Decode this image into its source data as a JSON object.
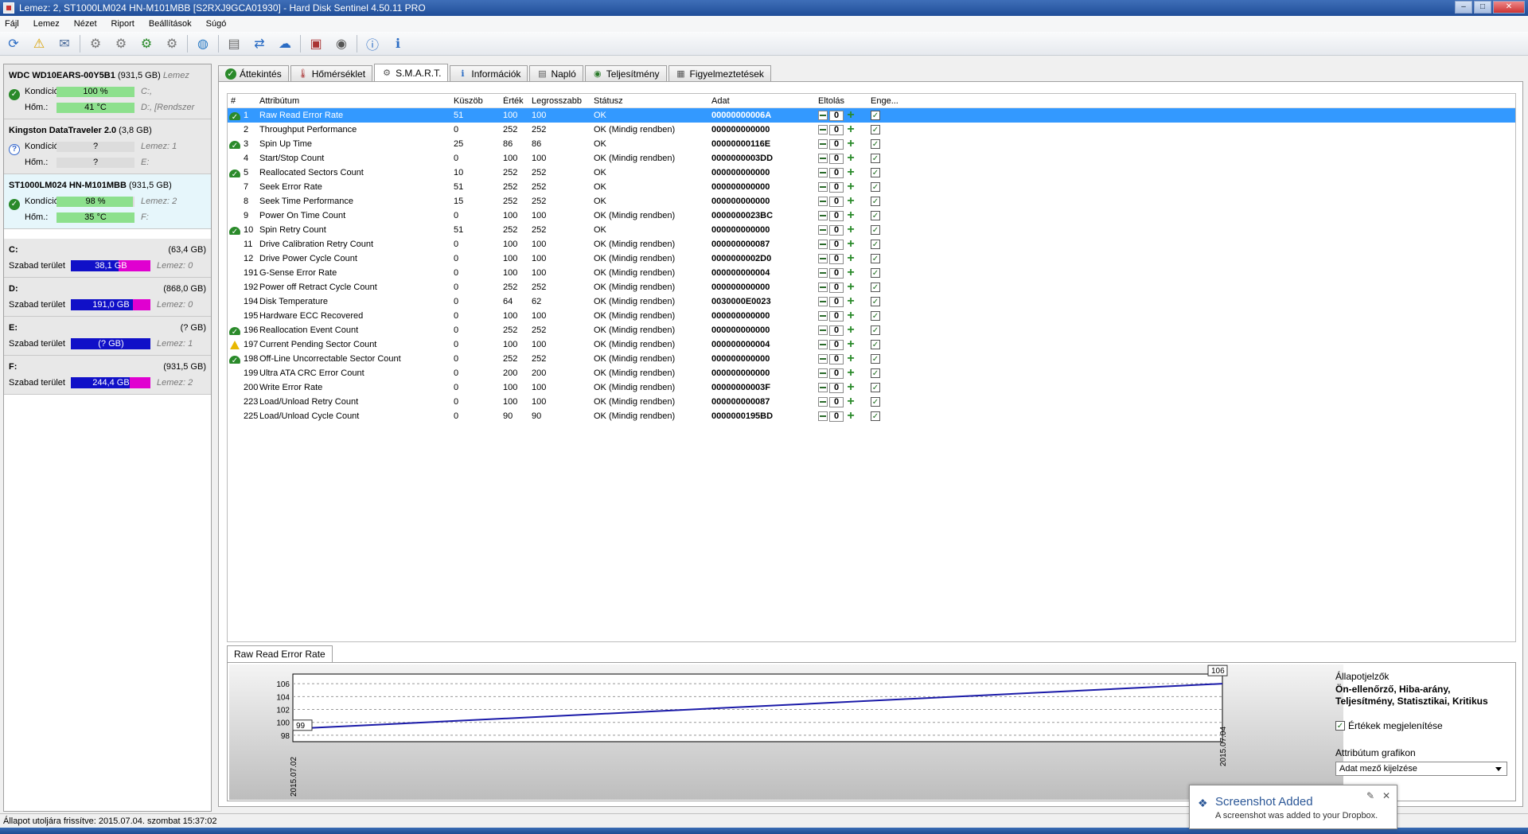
{
  "window": {
    "title": "Lemez: 2, ST1000LM024 HN-M101MBB [S2RXJ9GCA01930]  -  Hard Disk Sentinel 4.50.11 PRO",
    "min": "–",
    "max": "□",
    "close": "✕"
  },
  "menu": [
    "Fájl",
    "Lemez",
    "Nézet",
    "Riport",
    "Beállítások",
    "Súgó"
  ],
  "disks": [
    {
      "name": "WDC WD10EARS-00Y5B1",
      "size": "(931,5 GB)",
      "tail": "Lemez",
      "cond_label": "Kondíció:",
      "cond": "100 %",
      "cond_pct": 100,
      "cond_extra": "C:,",
      "temp_label": "Hőm.:",
      "temp": "41 °C",
      "temp_extra": "D:, [Rendszer",
      "status": "ok"
    },
    {
      "name": "Kingston DataTraveler 2.0",
      "size": "(3,8 GB)",
      "tail": "",
      "cond_label": "Kondíció:",
      "cond": "?",
      "cond_pct": 0,
      "cond_extra": "Lemez: 1",
      "temp_label": "Hőm.:",
      "temp": "?",
      "temp_extra": "E:",
      "status": "unknown"
    },
    {
      "name": "ST1000LM024 HN-M101MBB",
      "size": "(931,5 GB)",
      "tail": "",
      "cond_label": "Kondíció:",
      "cond": "98 %",
      "cond_pct": 98,
      "cond_extra": "Lemez: 2",
      "temp_label": "Hőm.:",
      "temp": "35 °C",
      "temp_extra": "F:",
      "status": "ok"
    }
  ],
  "volumes": [
    {
      "letter": "C:",
      "size": "(63,4 GB)",
      "free_label": "Szabad terület",
      "free": "38,1 GB",
      "free_pct": 60,
      "disk": "Lemez: 0"
    },
    {
      "letter": "D:",
      "size": "(868,0 GB)",
      "free_label": "Szabad terület",
      "free": "191,0 GB",
      "free_pct": 78,
      "disk": "Lemez: 0"
    },
    {
      "letter": "E:",
      "size": "(? GB)",
      "free_label": "Szabad terület",
      "free": "(? GB)",
      "free_pct": 100,
      "disk": "Lemez: 1"
    },
    {
      "letter": "F:",
      "size": "(931,5 GB)",
      "free_label": "Szabad terület",
      "free": "244,4 GB",
      "free_pct": 74,
      "disk": "Lemez: 2"
    }
  ],
  "tabs": [
    "Áttekintés",
    "Hőmérséklet",
    "S.M.A.R.T.",
    "Információk",
    "Napló",
    "Teljesítmény",
    "Figyelmeztetések"
  ],
  "tab_icons": [
    "check-icon",
    "thermometer-icon",
    "smart-icon",
    "info-icon",
    "log-icon",
    "performance-icon",
    "warning-list-icon"
  ],
  "smart_headers": [
    "#",
    "Attribútum",
    "Küszöb",
    "Érték",
    "Legrosszabb",
    "Státusz",
    "Adat",
    "Eltolás",
    "Enge..."
  ],
  "smart_rows": [
    {
      "id": "1",
      "name": "Raw Read Error Rate",
      "thr": "51",
      "val": "100",
      "worst": "100",
      "status": "OK",
      "data": "00000000006A",
      "off": "0",
      "icon": "ok"
    },
    {
      "id": "2",
      "name": "Throughput Performance",
      "thr": "0",
      "val": "252",
      "worst": "252",
      "status": "OK (Mindig rendben)",
      "data": "000000000000",
      "off": "0",
      "icon": ""
    },
    {
      "id": "3",
      "name": "Spin Up Time",
      "thr": "25",
      "val": "86",
      "worst": "86",
      "status": "OK",
      "data": "00000000116E",
      "off": "0",
      "icon": "ok"
    },
    {
      "id": "4",
      "name": "Start/Stop Count",
      "thr": "0",
      "val": "100",
      "worst": "100",
      "status": "OK (Mindig rendben)",
      "data": "0000000003DD",
      "off": "0",
      "icon": ""
    },
    {
      "id": "5",
      "name": "Reallocated Sectors Count",
      "thr": "10",
      "val": "252",
      "worst": "252",
      "status": "OK",
      "data": "000000000000",
      "off": "0",
      "icon": "ok"
    },
    {
      "id": "7",
      "name": "Seek Error Rate",
      "thr": "51",
      "val": "252",
      "worst": "252",
      "status": "OK",
      "data": "000000000000",
      "off": "0",
      "icon": ""
    },
    {
      "id": "8",
      "name": "Seek Time Performance",
      "thr": "15",
      "val": "252",
      "worst": "252",
      "status": "OK",
      "data": "000000000000",
      "off": "0",
      "icon": ""
    },
    {
      "id": "9",
      "name": "Power On Time Count",
      "thr": "0",
      "val": "100",
      "worst": "100",
      "status": "OK (Mindig rendben)",
      "data": "0000000023BC",
      "off": "0",
      "icon": ""
    },
    {
      "id": "10",
      "name": "Spin Retry Count",
      "thr": "51",
      "val": "252",
      "worst": "252",
      "status": "OK",
      "data": "000000000000",
      "off": "0",
      "icon": "ok"
    },
    {
      "id": "11",
      "name": "Drive Calibration Retry Count",
      "thr": "0",
      "val": "100",
      "worst": "100",
      "status": "OK (Mindig rendben)",
      "data": "000000000087",
      "off": "0",
      "icon": ""
    },
    {
      "id": "12",
      "name": "Drive Power Cycle Count",
      "thr": "0",
      "val": "100",
      "worst": "100",
      "status": "OK (Mindig rendben)",
      "data": "0000000002D0",
      "off": "0",
      "icon": ""
    },
    {
      "id": "191",
      "name": "G-Sense Error Rate",
      "thr": "0",
      "val": "100",
      "worst": "100",
      "status": "OK (Mindig rendben)",
      "data": "000000000004",
      "off": "0",
      "icon": ""
    },
    {
      "id": "192",
      "name": "Power off Retract Cycle Count",
      "thr": "0",
      "val": "252",
      "worst": "252",
      "status": "OK (Mindig rendben)",
      "data": "000000000000",
      "off": "0",
      "icon": ""
    },
    {
      "id": "194",
      "name": "Disk Temperature",
      "thr": "0",
      "val": "64",
      "worst": "62",
      "status": "OK (Mindig rendben)",
      "data": "0030000E0023",
      "off": "0",
      "icon": ""
    },
    {
      "id": "195",
      "name": "Hardware ECC Recovered",
      "thr": "0",
      "val": "100",
      "worst": "100",
      "status": "OK (Mindig rendben)",
      "data": "000000000000",
      "off": "0",
      "icon": ""
    },
    {
      "id": "196",
      "name": "Reallocation Event Count",
      "thr": "0",
      "val": "252",
      "worst": "252",
      "status": "OK (Mindig rendben)",
      "data": "000000000000",
      "off": "0",
      "icon": "ok"
    },
    {
      "id": "197",
      "name": "Current Pending Sector Count",
      "thr": "0",
      "val": "100",
      "worst": "100",
      "status": "OK (Mindig rendben)",
      "data": "000000000004",
      "off": "0",
      "icon": "warn"
    },
    {
      "id": "198",
      "name": "Off-Line Uncorrectable Sector Count",
      "thr": "0",
      "val": "252",
      "worst": "252",
      "status": "OK (Mindig rendben)",
      "data": "000000000000",
      "off": "0",
      "icon": "ok"
    },
    {
      "id": "199",
      "name": "Ultra ATA CRC Error Count",
      "thr": "0",
      "val": "200",
      "worst": "200",
      "status": "OK (Mindig rendben)",
      "data": "000000000000",
      "off": "0",
      "icon": ""
    },
    {
      "id": "200",
      "name": "Write Error Rate",
      "thr": "0",
      "val": "100",
      "worst": "100",
      "status": "OK (Mindig rendben)",
      "data": "00000000003F",
      "off": "0",
      "icon": ""
    },
    {
      "id": "223",
      "name": "Load/Unload Retry Count",
      "thr": "0",
      "val": "100",
      "worst": "100",
      "status": "OK (Mindig rendben)",
      "data": "000000000087",
      "off": "0",
      "icon": ""
    },
    {
      "id": "225",
      "name": "Load/Unload Cycle Count",
      "thr": "0",
      "val": "90",
      "worst": "90",
      "status": "OK (Mindig rendben)",
      "data": "0000000195BD",
      "off": "0",
      "icon": ""
    }
  ],
  "graph": {
    "tab": "Raw Read Error Rate",
    "y_ticks": [
      "106",
      "104",
      "102",
      "100",
      "98"
    ],
    "x_start": "2015.07.02",
    "x_end": "2015.07.04",
    "start_val": "99",
    "end_val": "106",
    "start_num": 99,
    "end_num": 106,
    "y_min": 97,
    "y_max": 107.5,
    "line_color": "#1a1aa8"
  },
  "side": {
    "title": "Állapotjelzők",
    "desc": "Ön-ellenőrző, Hiba-arány, Teljesítmény, Statisztikai, Kritikus",
    "show_values": "Értékek megjelenítése",
    "attr_graph": "Attribútum grafikon",
    "combo": "Adat mező kijelzése"
  },
  "status": "Állapot utoljára frissítve: 2015.07.04. szombat 15:37:02",
  "toast": {
    "title": "Screenshot Added",
    "msg": "A screenshot was added to your Dropbox."
  },
  "check": "✓",
  "colors": {
    "accent": "#3399ff",
    "ok": "#2a8a2a",
    "warn": "#e8b800",
    "free": "#1010c8",
    "used": "#e000d0",
    "health": "#8de08d"
  }
}
